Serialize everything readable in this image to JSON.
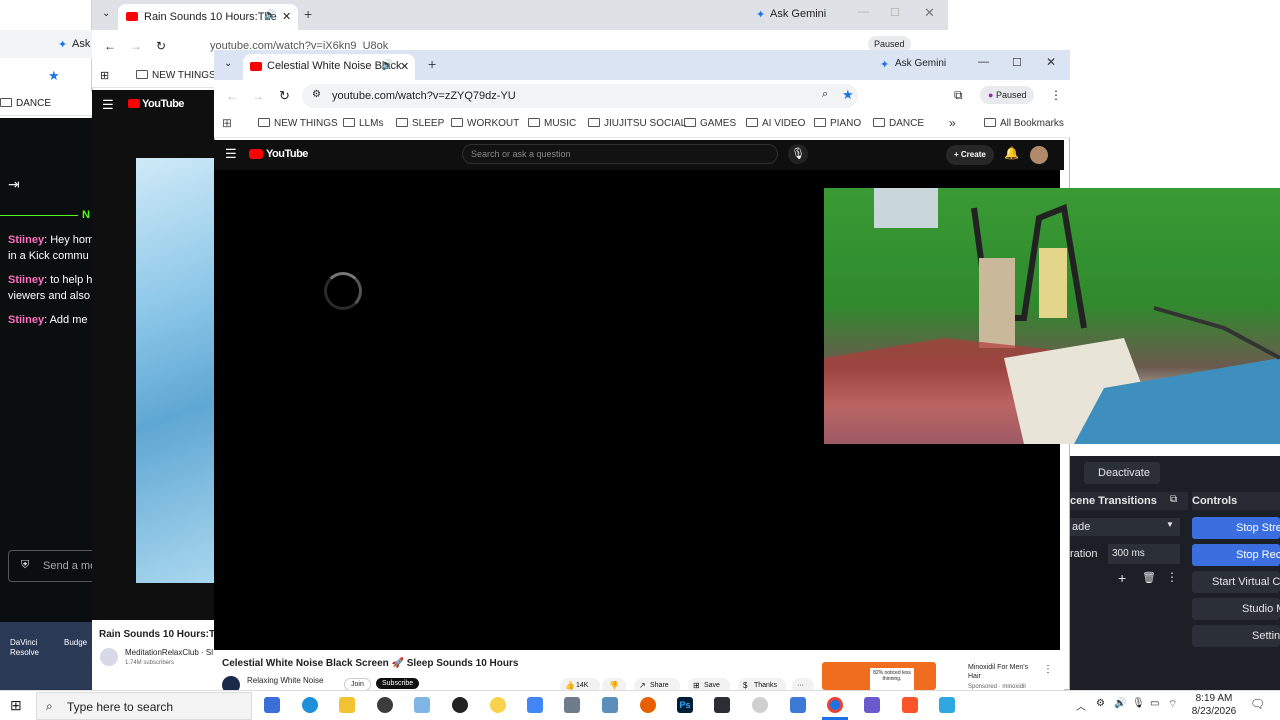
{
  "left_window": {
    "tab_label": "Ask",
    "bookmark": "DANCE",
    "chat_header": "N",
    "chat": [
      {
        "user": "Stiiney",
        "text": ": Hey hom"
      },
      {
        "user": "",
        "text": "in a Kick commu"
      },
      {
        "user": "Stiiney",
        "text": ": to help h"
      },
      {
        "user": "",
        "text": "viewers and also"
      },
      {
        "user": "Stiiney",
        "text": ": Add me"
      }
    ],
    "chat_input_placeholder": "Send a me",
    "desktop_icons": [
      "DaVinci Resolve",
      "Budge"
    ]
  },
  "back_browser": {
    "tab_title": "Rain Sounds 10 Hours:The",
    "gemini": "Ask Gemini",
    "url": "youtube.com/watch?v=iX6kn9_U8ok",
    "profile_status": "Paused",
    "bookmark": "NEW THINGS",
    "yt_logo": "YouTube",
    "video_title": "Rain Sounds 10 Hours:Th",
    "channel": "MeditationRelaxClub · Sl",
    "subs": "1.74M subscribers"
  },
  "front_browser": {
    "tab_title": "Celestial White Noise Black",
    "gemini": "Ask Gemini",
    "url": "youtube.com/watch?v=zZYQ79dz-YU",
    "profile_status": "Paused",
    "bookmarks": [
      "NEW THINGS",
      "LLMs",
      "SLEEP",
      "WORKOUT",
      "MUSIC",
      "JIUJITSU SOCIAL",
      "GAMES",
      "AI VIDEO",
      "PIANO",
      "DANCE"
    ],
    "all_bookmarks": "All Bookmarks",
    "more": "»",
    "yt": {
      "logo": "YouTube",
      "search_placeholder": "Search or ask a question",
      "create": "Create"
    },
    "video": {
      "title": "Celestial White Noise Black Screen 🚀 Sleep Sounds 10 Hours",
      "channel": "Relaxing White Noise",
      "join": "Join",
      "subscribe": "Subscribe",
      "likes": "14K",
      "share": "Share",
      "save": "Save",
      "thanks": "Thanks",
      "more": "···"
    },
    "ad": {
      "badge": "82% noticed less thinning.",
      "title": "Minoxidil For Men's Hair",
      "subtitle": "Sponsored · minoxidil"
    }
  },
  "obs": {
    "deactivate": "Deactivate",
    "transitions_title": "cene Transitions",
    "transition_select": "ade",
    "duration_label": "ration",
    "duration_value": "300 ms",
    "controls_title": "Controls",
    "stop_stream": "Stop Strea",
    "stop_record": "Stop Reco",
    "virtual_cam": "Start Virtual Ca",
    "studio_mode": "Studio M",
    "settings": "Settin"
  },
  "taskbar": {
    "search_placeholder": "Type here to search",
    "time": "8:19 AM",
    "date": "8/23/2026"
  },
  "colors": {
    "yt_red": "#ff0000",
    "accent_blue": "#1a73e8",
    "obs_blue": "#3b6fe0"
  }
}
